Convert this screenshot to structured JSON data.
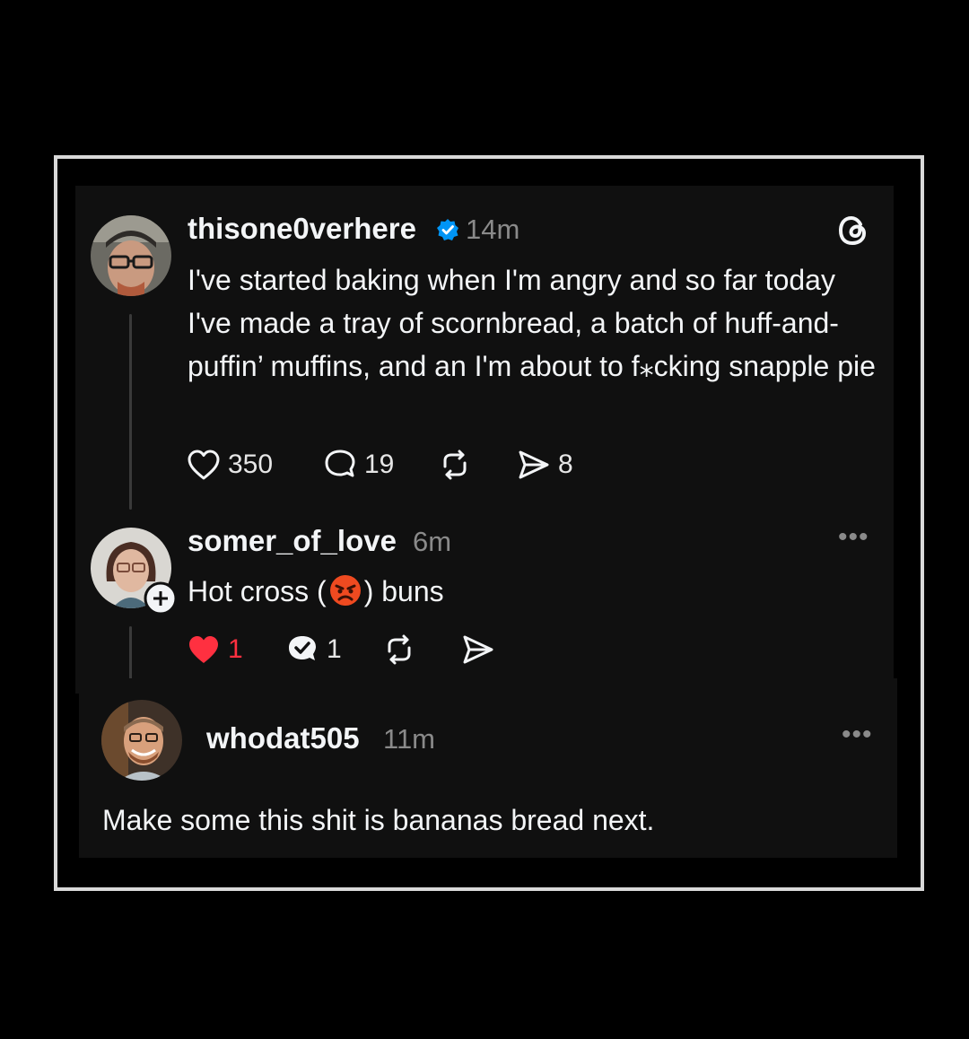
{
  "post": {
    "username": "thisone0verhere",
    "time": "14m",
    "verified": true,
    "text": "I've started baking when I'm angry and so far today I've made a tray of scornbread, a batch of huff-and-puffin’ muffins, and an I'm about to f⁎cking snapple pie",
    "likes": "350",
    "replies": "19",
    "shares": "8",
    "app_icon": "threads-logo-icon"
  },
  "reply": {
    "username": "somer_of_love",
    "time": "6m",
    "text_before": "Hot cross (",
    "emoji": "angry-face-emoji",
    "text_after": ") buns",
    "likes": "1",
    "replies": "1",
    "liked": true
  },
  "comment": {
    "username": "whodat505",
    "time": "11m",
    "text": "Make some this shit is bananas bread next."
  },
  "colors": {
    "background": "#000000",
    "card": "#101010",
    "frame": "#d9d9d9",
    "verified": "#0095f6",
    "heart_liked": "#ff3040",
    "muted": "#8a8a8a"
  }
}
